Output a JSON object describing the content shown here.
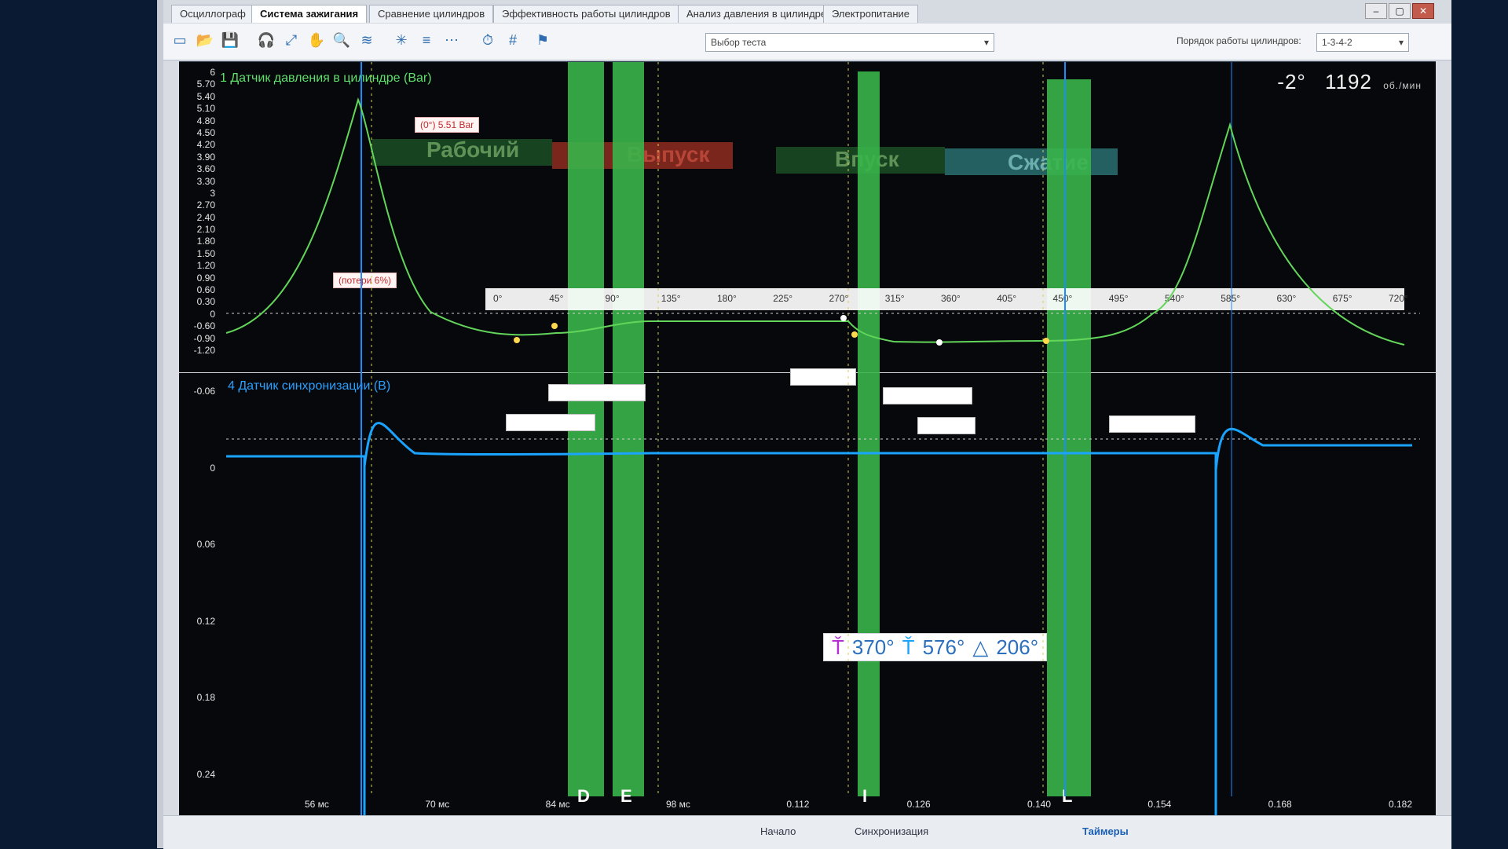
{
  "tabs": [
    {
      "label": "Осциллограф"
    },
    {
      "label": "Система зажигания"
    },
    {
      "label": "Сравнение цилиндров"
    },
    {
      "label": "Эффективность работы цилиндров"
    },
    {
      "label": "Анализ давления в цилиндре"
    },
    {
      "label": "Электропитание"
    }
  ],
  "toolbar": {
    "test_select_label": "Выбор теста",
    "firing_order_label": "Порядок работы цилиндров:",
    "firing_order_value": "1-3-4-2"
  },
  "readout": {
    "angle": "-2°",
    "rpm": "1192",
    "rpm_unit": "об./мин"
  },
  "pane1": {
    "title": "1 Датчик давления в цилиндре (Bar)",
    "y_ticks": [
      "6",
      "5.70",
      "5.40",
      "5.10",
      "4.80",
      "4.50",
      "4.20",
      "3.90",
      "3.60",
      "3.30",
      "3",
      "2.70",
      "2.40",
      "2.10",
      "1.80",
      "1.50",
      "1.20",
      "0.90",
      "0.60",
      "0.30",
      "0",
      "-0.60",
      "-0.90",
      "-1.20"
    ],
    "peak_label": "(0°) 5.51 Bar",
    "loss_label": "(потери 6%)",
    "phases": [
      "Рабочий",
      "Выпуск",
      "Впуск",
      "Сжатие"
    ],
    "deg_ticks": [
      "0°",
      "45°",
      "90°",
      "135°",
      "180°",
      "225°",
      "270°",
      "315°",
      "360°",
      "405°",
      "450°",
      "495°",
      "540°",
      "585°",
      "630°",
      "675°",
      "720°"
    ]
  },
  "pane2": {
    "title": "4 Датчик синхронизации (В)",
    "y_ticks": [
      "-0.06",
      "0",
      "0.06",
      "0.12",
      "0.18",
      "0.24"
    ]
  },
  "x_ticks": [
    "56 мс",
    "70 мс",
    "84 мс",
    "98 мс",
    "0.112",
    "0.126",
    "0.140",
    "0.154",
    "0.168",
    "0.182"
  ],
  "markers": [
    "D",
    "E",
    "I",
    "L"
  ],
  "cursor": {
    "a": "370°",
    "b": "576°",
    "delta": "206°"
  },
  "bottom": {
    "left": "Таймеры",
    "sync": "Синхронизация",
    "item": "Начало"
  }
}
